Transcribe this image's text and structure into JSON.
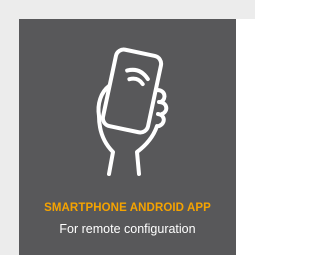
{
  "card": {
    "title": "SMARTPHONE ANDROID APP",
    "subtitle": "For remote configuration",
    "icon": "hand-holding-smartphone-icon"
  },
  "colors": {
    "card_background": "#58585a",
    "title": "#f5a300",
    "subtitle": "#ffffff",
    "icon_stroke": "#ffffff",
    "page_background": "#ececec"
  }
}
